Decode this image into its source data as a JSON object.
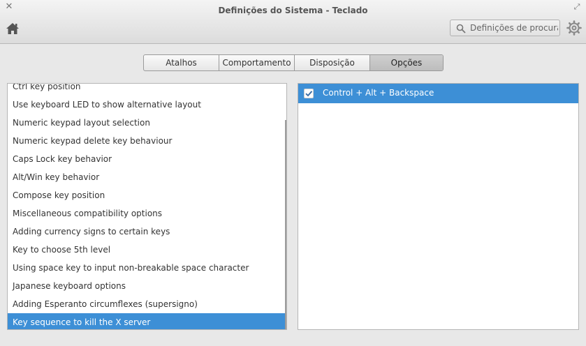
{
  "window": {
    "title": "Definições do Sistema - Teclado",
    "close_glyph": "✕",
    "max_glyph": "⤢"
  },
  "toolbar": {
    "home_icon": "home-icon",
    "search_placeholder": "Definições de procura",
    "settings_icon": "gear-icon"
  },
  "tabs": [
    {
      "label": "Atalhos"
    },
    {
      "label": "Comportamento"
    },
    {
      "label": "Disposição"
    },
    {
      "label": "Opções",
      "active": true
    }
  ],
  "option_groups": [
    {
      "label": "Ctrl key position"
    },
    {
      "label": "Use keyboard LED to show alternative layout"
    },
    {
      "label": "Numeric keypad layout selection"
    },
    {
      "label": "Numeric keypad delete key behaviour"
    },
    {
      "label": "Caps Lock key behavior"
    },
    {
      "label": "Alt/Win key behavior"
    },
    {
      "label": "Compose key position"
    },
    {
      "label": "Miscellaneous compatibility options"
    },
    {
      "label": "Adding currency signs to certain keys"
    },
    {
      "label": "Key to choose 5th level"
    },
    {
      "label": "Using space key to input non-breakable space character"
    },
    {
      "label": "Japanese keyboard options"
    },
    {
      "label": "Adding Esperanto circumflexes (supersigno)"
    },
    {
      "label": "Key sequence to kill the X server",
      "selected": true
    }
  ],
  "options": [
    {
      "label": "Control + Alt + Backspace",
      "checked": true
    }
  ],
  "colors": {
    "selection": "#3d8fd6",
    "background": "#e8e8e8"
  }
}
